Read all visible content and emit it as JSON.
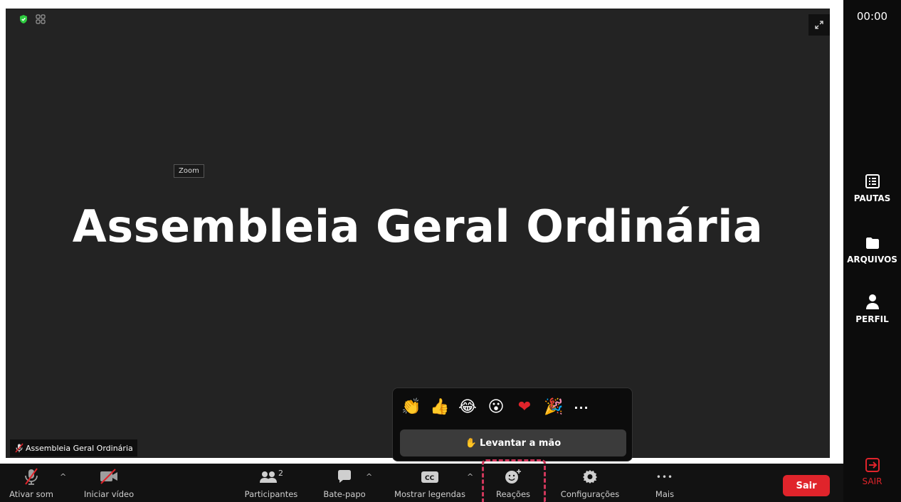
{
  "meeting": {
    "title": "Assembleia Geral Ordinária",
    "tooltip": "Zoom",
    "participant_name": "Assembleia Geral Ordinária"
  },
  "reactions": {
    "emojis": [
      {
        "icon": "clap-emoji",
        "glyph": "👏"
      },
      {
        "icon": "thumbs-up-emoji",
        "glyph": "👍"
      },
      {
        "icon": "tears-of-joy-emoji",
        "glyph": "😂"
      },
      {
        "icon": "surprised-emoji",
        "glyph": "😮"
      },
      {
        "icon": "heart-emoji",
        "glyph": "❤"
      },
      {
        "icon": "party-popper-emoji",
        "glyph": "🎉"
      }
    ],
    "more": "···",
    "raise_hand_label": "Levantar a mão",
    "raise_hand_glyph": "✋"
  },
  "toolbar": {
    "mute_label": "Ativar som",
    "video_label": "Iniciar vídeo",
    "participants_label": "Participantes",
    "participants_count": "2",
    "chat_label": "Bate-papo",
    "captions_label": "Mostrar legendas",
    "captions_icon_text": "CC",
    "reactions_label": "Reações",
    "settings_label": "Configurações",
    "more_label": "Mais",
    "leave_label": "Sair",
    "more_dots": "•••"
  },
  "sidebar": {
    "timer": "00:00",
    "items": [
      {
        "label": "PAUTAS"
      },
      {
        "label": "ARQUIVOS"
      },
      {
        "label": "PERFIL"
      }
    ],
    "exit_label": "SAIR"
  },
  "colors": {
    "stage_bg": "#232323",
    "accent_red": "#e0242b",
    "highlight": "#d0375b",
    "secure_green": "#2ecc40"
  }
}
